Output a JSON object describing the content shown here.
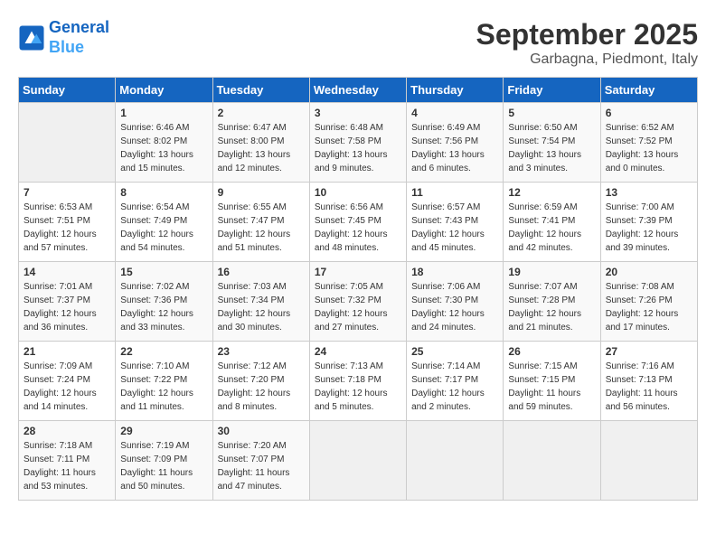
{
  "header": {
    "logo_line1": "General",
    "logo_line2": "Blue",
    "month": "September 2025",
    "location": "Garbagna, Piedmont, Italy"
  },
  "days_of_week": [
    "Sunday",
    "Monday",
    "Tuesday",
    "Wednesday",
    "Thursday",
    "Friday",
    "Saturday"
  ],
  "weeks": [
    [
      {
        "day": "",
        "info": ""
      },
      {
        "day": "1",
        "info": "Sunrise: 6:46 AM\nSunset: 8:02 PM\nDaylight: 13 hours\nand 15 minutes."
      },
      {
        "day": "2",
        "info": "Sunrise: 6:47 AM\nSunset: 8:00 PM\nDaylight: 13 hours\nand 12 minutes."
      },
      {
        "day": "3",
        "info": "Sunrise: 6:48 AM\nSunset: 7:58 PM\nDaylight: 13 hours\nand 9 minutes."
      },
      {
        "day": "4",
        "info": "Sunrise: 6:49 AM\nSunset: 7:56 PM\nDaylight: 13 hours\nand 6 minutes."
      },
      {
        "day": "5",
        "info": "Sunrise: 6:50 AM\nSunset: 7:54 PM\nDaylight: 13 hours\nand 3 minutes."
      },
      {
        "day": "6",
        "info": "Sunrise: 6:52 AM\nSunset: 7:52 PM\nDaylight: 13 hours\nand 0 minutes."
      }
    ],
    [
      {
        "day": "7",
        "info": "Sunrise: 6:53 AM\nSunset: 7:51 PM\nDaylight: 12 hours\nand 57 minutes."
      },
      {
        "day": "8",
        "info": "Sunrise: 6:54 AM\nSunset: 7:49 PM\nDaylight: 12 hours\nand 54 minutes."
      },
      {
        "day": "9",
        "info": "Sunrise: 6:55 AM\nSunset: 7:47 PM\nDaylight: 12 hours\nand 51 minutes."
      },
      {
        "day": "10",
        "info": "Sunrise: 6:56 AM\nSunset: 7:45 PM\nDaylight: 12 hours\nand 48 minutes."
      },
      {
        "day": "11",
        "info": "Sunrise: 6:57 AM\nSunset: 7:43 PM\nDaylight: 12 hours\nand 45 minutes."
      },
      {
        "day": "12",
        "info": "Sunrise: 6:59 AM\nSunset: 7:41 PM\nDaylight: 12 hours\nand 42 minutes."
      },
      {
        "day": "13",
        "info": "Sunrise: 7:00 AM\nSunset: 7:39 PM\nDaylight: 12 hours\nand 39 minutes."
      }
    ],
    [
      {
        "day": "14",
        "info": "Sunrise: 7:01 AM\nSunset: 7:37 PM\nDaylight: 12 hours\nand 36 minutes."
      },
      {
        "day": "15",
        "info": "Sunrise: 7:02 AM\nSunset: 7:36 PM\nDaylight: 12 hours\nand 33 minutes."
      },
      {
        "day": "16",
        "info": "Sunrise: 7:03 AM\nSunset: 7:34 PM\nDaylight: 12 hours\nand 30 minutes."
      },
      {
        "day": "17",
        "info": "Sunrise: 7:05 AM\nSunset: 7:32 PM\nDaylight: 12 hours\nand 27 minutes."
      },
      {
        "day": "18",
        "info": "Sunrise: 7:06 AM\nSunset: 7:30 PM\nDaylight: 12 hours\nand 24 minutes."
      },
      {
        "day": "19",
        "info": "Sunrise: 7:07 AM\nSunset: 7:28 PM\nDaylight: 12 hours\nand 21 minutes."
      },
      {
        "day": "20",
        "info": "Sunrise: 7:08 AM\nSunset: 7:26 PM\nDaylight: 12 hours\nand 17 minutes."
      }
    ],
    [
      {
        "day": "21",
        "info": "Sunrise: 7:09 AM\nSunset: 7:24 PM\nDaylight: 12 hours\nand 14 minutes."
      },
      {
        "day": "22",
        "info": "Sunrise: 7:10 AM\nSunset: 7:22 PM\nDaylight: 12 hours\nand 11 minutes."
      },
      {
        "day": "23",
        "info": "Sunrise: 7:12 AM\nSunset: 7:20 PM\nDaylight: 12 hours\nand 8 minutes."
      },
      {
        "day": "24",
        "info": "Sunrise: 7:13 AM\nSunset: 7:18 PM\nDaylight: 12 hours\nand 5 minutes."
      },
      {
        "day": "25",
        "info": "Sunrise: 7:14 AM\nSunset: 7:17 PM\nDaylight: 12 hours\nand 2 minutes."
      },
      {
        "day": "26",
        "info": "Sunrise: 7:15 AM\nSunset: 7:15 PM\nDaylight: 11 hours\nand 59 minutes."
      },
      {
        "day": "27",
        "info": "Sunrise: 7:16 AM\nSunset: 7:13 PM\nDaylight: 11 hours\nand 56 minutes."
      }
    ],
    [
      {
        "day": "28",
        "info": "Sunrise: 7:18 AM\nSunset: 7:11 PM\nDaylight: 11 hours\nand 53 minutes."
      },
      {
        "day": "29",
        "info": "Sunrise: 7:19 AM\nSunset: 7:09 PM\nDaylight: 11 hours\nand 50 minutes."
      },
      {
        "day": "30",
        "info": "Sunrise: 7:20 AM\nSunset: 7:07 PM\nDaylight: 11 hours\nand 47 minutes."
      },
      {
        "day": "",
        "info": ""
      },
      {
        "day": "",
        "info": ""
      },
      {
        "day": "",
        "info": ""
      },
      {
        "day": "",
        "info": ""
      }
    ]
  ]
}
